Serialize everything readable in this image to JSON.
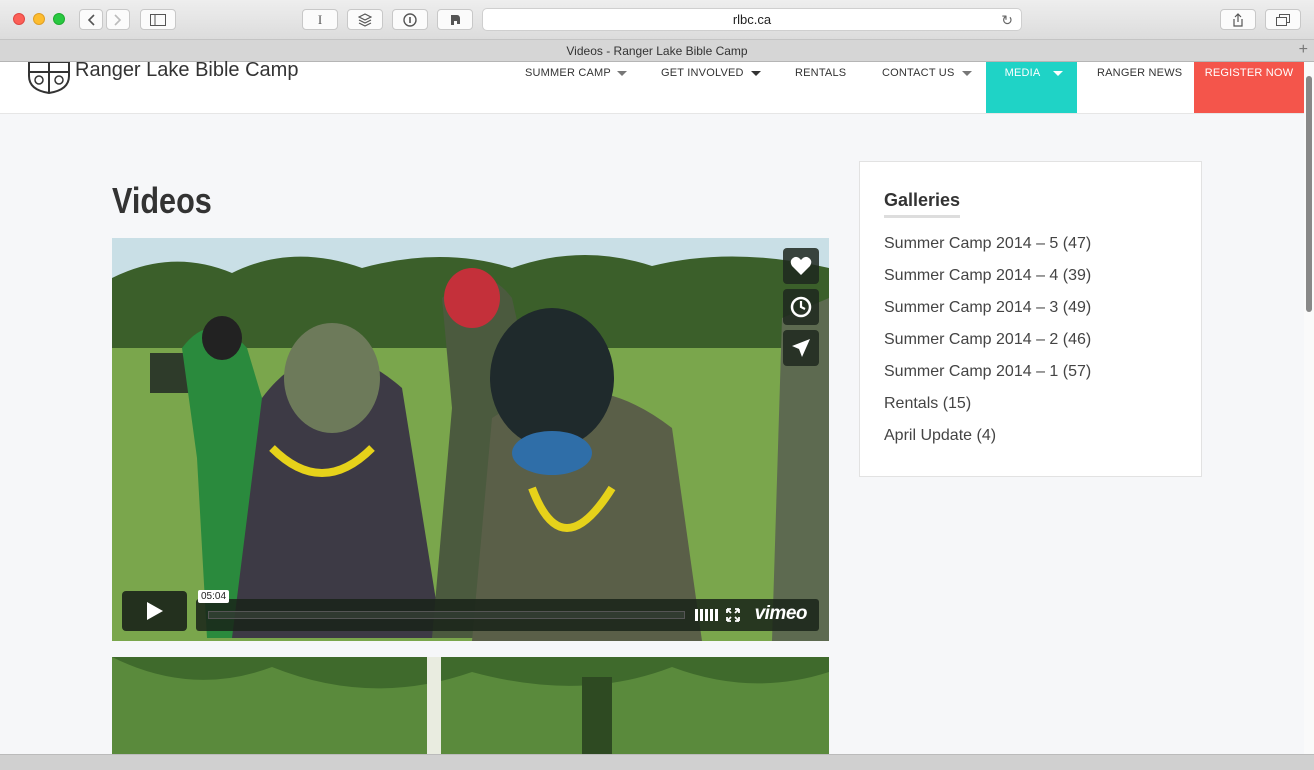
{
  "browser": {
    "url": "rlbc.ca",
    "tab_title": "Videos - Ranger Lake Bible Camp",
    "reader_label": "I"
  },
  "site": {
    "logo_text": "Ranger Lake Bible Camp",
    "nav": [
      {
        "label": "SUMMER CAMP",
        "has_dropdown": true
      },
      {
        "label": "GET INVOLVED",
        "has_dropdown": true
      },
      {
        "label": "RENTALS",
        "has_dropdown": false
      },
      {
        "label": "CONTACT US",
        "has_dropdown": true
      },
      {
        "label": "MEDIA",
        "has_dropdown": true,
        "active": true
      },
      {
        "label": "RANGER NEWS",
        "has_dropdown": false
      },
      {
        "label": "REGISTER NOW",
        "has_dropdown": false
      }
    ],
    "colors": {
      "media_active": "#1fd3c6",
      "register": "#f4554b"
    }
  },
  "main": {
    "title": "Videos",
    "video": {
      "timecode": "05:04",
      "brand": "vimeo"
    }
  },
  "sidebar": {
    "title": "Galleries",
    "items": [
      {
        "label": "Summer Camp 2014 – 5 (47)"
      },
      {
        "label": "Summer Camp 2014 – 4 (39)"
      },
      {
        "label": "Summer Camp 2014 – 3 (49)"
      },
      {
        "label": "Summer Camp 2014 – 2 (46)"
      },
      {
        "label": "Summer Camp 2014 – 1 (57)"
      },
      {
        "label": "Rentals (15)"
      },
      {
        "label": "April Update (4)"
      }
    ]
  }
}
